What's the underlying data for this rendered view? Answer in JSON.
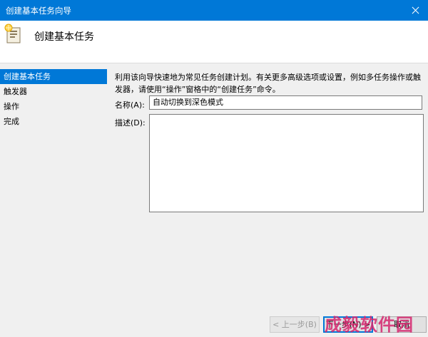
{
  "window": {
    "title": "创建基本任务向导"
  },
  "header": {
    "title": "创建基本任务",
    "icon": "task-scheduler-icon"
  },
  "sidebar": {
    "items": [
      {
        "label": "创建基本任务",
        "active": true
      },
      {
        "label": "触发器"
      },
      {
        "label": "操作"
      },
      {
        "label": "完成"
      }
    ]
  },
  "main": {
    "description": "利用该向导快速地为常见任务创建计划。有关更多高级选项或设置，例如多任务操作或触发器，请使用“操作”窗格中的“创建任务”命令。",
    "name_label": "名称(A):",
    "name_value": "自动切换到深色模式",
    "desc_label": "描述(D):",
    "desc_value": ""
  },
  "buttons": {
    "prev": "< 上一步(B)",
    "next": "下一步(N) >",
    "cancel": "取消"
  },
  "watermark": "成毅软件园",
  "colors": {
    "accent": "#0078d7",
    "watermark": "#d6266e"
  }
}
